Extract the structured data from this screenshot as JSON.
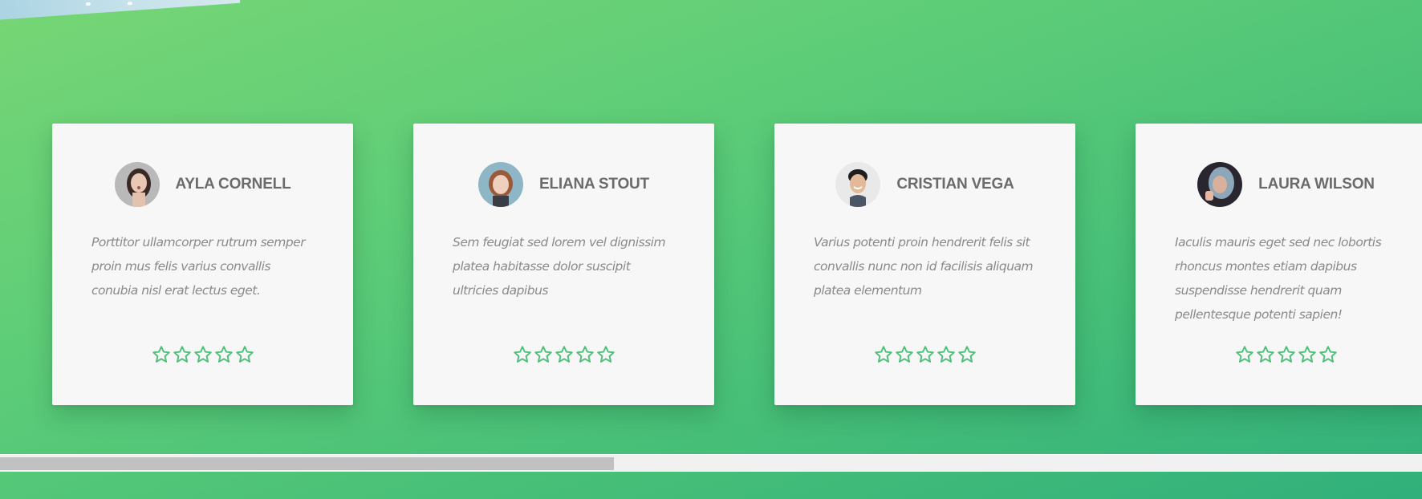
{
  "colors": {
    "accent": "#4cbf78",
    "card_background": "#f7f7f7",
    "name_text": "#6b6b6b",
    "quote_text": "#8a8a8a"
  },
  "testimonials": [
    {
      "name": "AYLA CORNELL",
      "quote": "Porttitor ullamcorper rutrum semper proin mus felis varius convallis conubia nisl erat lectus eget.",
      "rating_icons": "star-outline-icon"
    },
    {
      "name": "ELIANA STOUT",
      "quote": "Sem feugiat sed lorem vel dignissim platea habitasse dolor suscipit ultricies dapibus",
      "rating_icons": "star-outline-icon"
    },
    {
      "name": "CRISTIAN VEGA",
      "quote": "Varius potenti proin hendrerit felis sit convallis nunc non id facilisis aliquam platea elementum",
      "rating_icons": "star-outline-icon"
    },
    {
      "name": "LAURA WILSON",
      "quote": "Iaculis mauris eget sed nec lobortis rhoncus montes etiam dapibus suspendisse hendrerit quam pellentesque potenti sapien!",
      "rating_icons": "star-outline-icon"
    }
  ],
  "scrollbar": {
    "position_fraction": 0.432
  }
}
